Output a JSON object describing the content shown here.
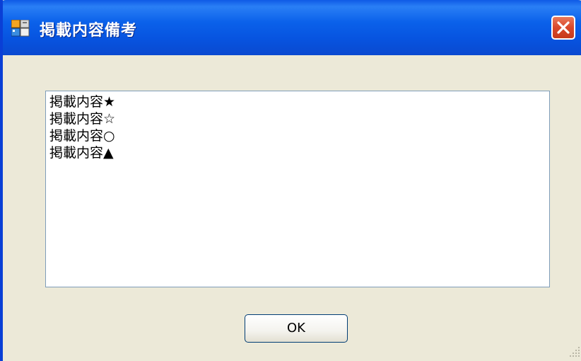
{
  "window": {
    "title": "掲載内容備考",
    "colors": {
      "titlebar": "#0754e0",
      "body": "#ece9d8",
      "close_button": "#d9472a"
    }
  },
  "icons": {
    "app_icon": "app-window-icon",
    "close_icon": "close-x-icon",
    "grip_icon": "resize-grip-icon"
  },
  "content": {
    "lines": [
      "掲載内容★",
      "掲載内容☆",
      "掲載内容○",
      "掲載内容▲"
    ]
  },
  "buttons": {
    "ok_label": "OK"
  }
}
